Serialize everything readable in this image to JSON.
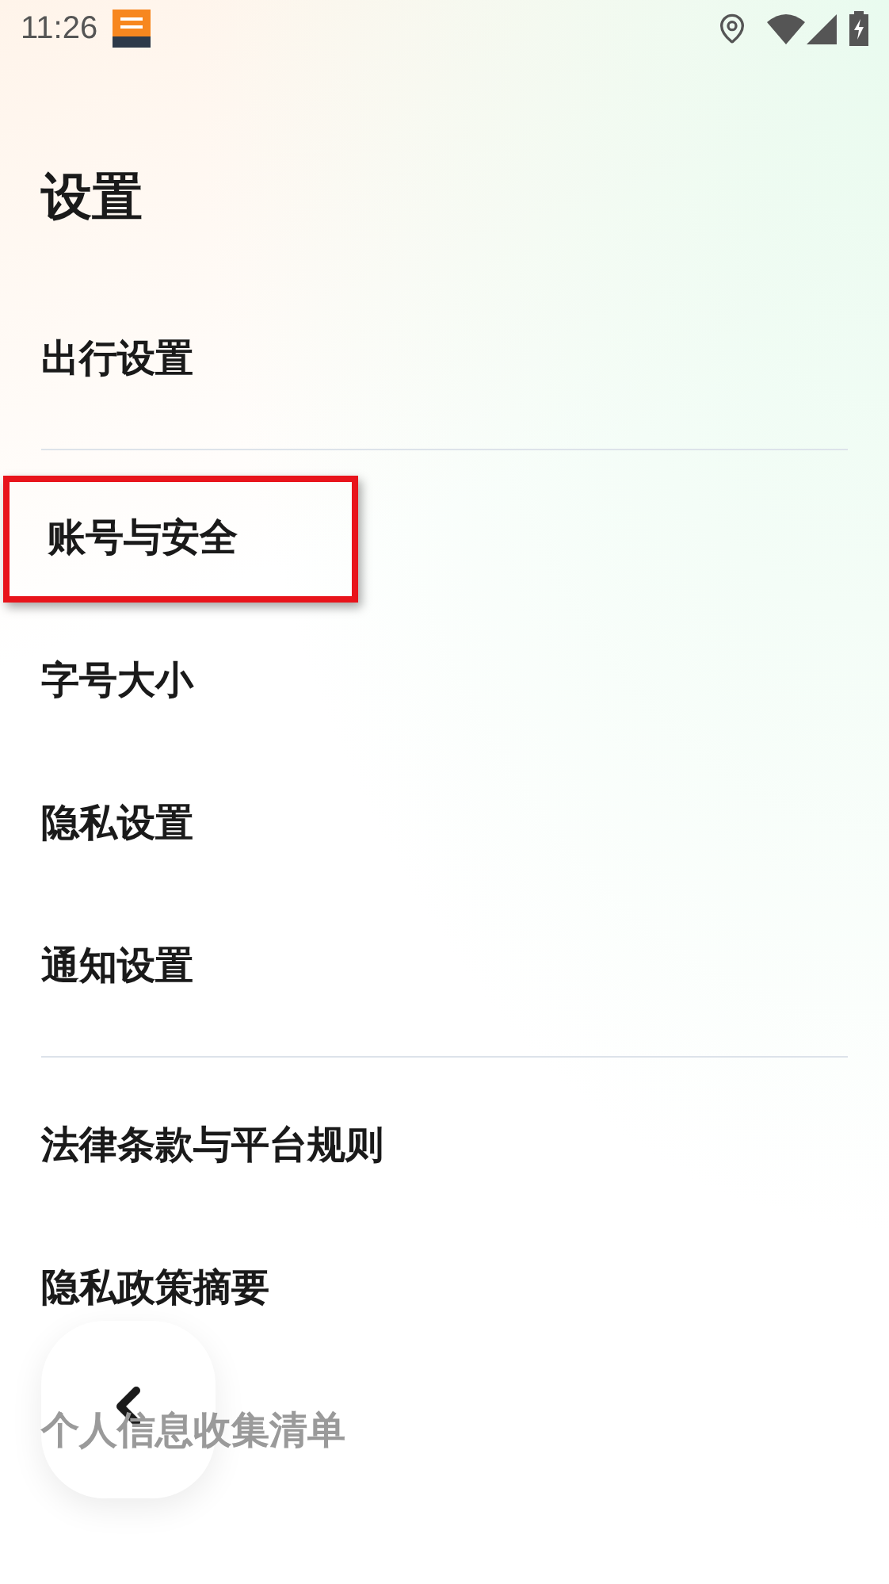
{
  "status_bar": {
    "time": "11:26"
  },
  "title": "设置",
  "groups": [
    {
      "items": [
        {
          "label": "出行设置",
          "highlighted": false,
          "faded": false
        }
      ]
    },
    {
      "items": [
        {
          "label": "账号与安全",
          "highlighted": true,
          "faded": false
        },
        {
          "label": "字号大小",
          "highlighted": false,
          "faded": false
        },
        {
          "label": "隐私设置",
          "highlighted": false,
          "faded": false
        },
        {
          "label": "通知设置",
          "highlighted": false,
          "faded": false
        }
      ]
    },
    {
      "items": [
        {
          "label": "法律条款与平台规则",
          "highlighted": false,
          "faded": false
        },
        {
          "label": "隐私政策摘要",
          "highlighted": false,
          "faded": false
        },
        {
          "label": "个人信息收集清单",
          "highlighted": false,
          "faded": true
        }
      ]
    }
  ]
}
